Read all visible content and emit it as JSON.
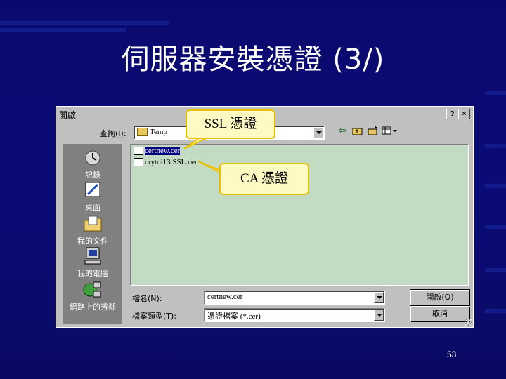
{
  "slide": {
    "title": "伺服器安裝憑證 (3/)",
    "page_number": "53"
  },
  "dialog": {
    "title": "開啟",
    "help_button": "?",
    "close_button": "×",
    "look_in_label": "查詢(I):",
    "look_in_value": "Temp",
    "places": [
      {
        "label": "記錄",
        "icon": "history-icon"
      },
      {
        "label": "桌面",
        "icon": "desktop-icon"
      },
      {
        "label": "我的文件",
        "icon": "my-documents-icon"
      },
      {
        "label": "我的電腦",
        "icon": "my-computer-icon"
      },
      {
        "label": "網路上的芳鄰",
        "icon": "network-icon"
      }
    ],
    "files": [
      {
        "name": "certnew.cer",
        "selected": true
      },
      {
        "name": "crytoi13 SSL.cer",
        "selected": false
      }
    ],
    "filename_label": "檔名(N):",
    "filename_value": "certnew.cer",
    "filetype_label": "檔案類型(T):",
    "filetype_value": "憑證檔案 (*.cer)",
    "open_button": "開啟(O)",
    "cancel_button": "取消"
  },
  "callouts": {
    "ssl": "SSL 憑證",
    "ca": "CA 憑證"
  },
  "colors": {
    "background": "#0a0a6e",
    "selection": "#000080",
    "callout_fill": "#fff9c4",
    "callout_border": "#e8c200",
    "list_bg": "#c3dbc3"
  }
}
